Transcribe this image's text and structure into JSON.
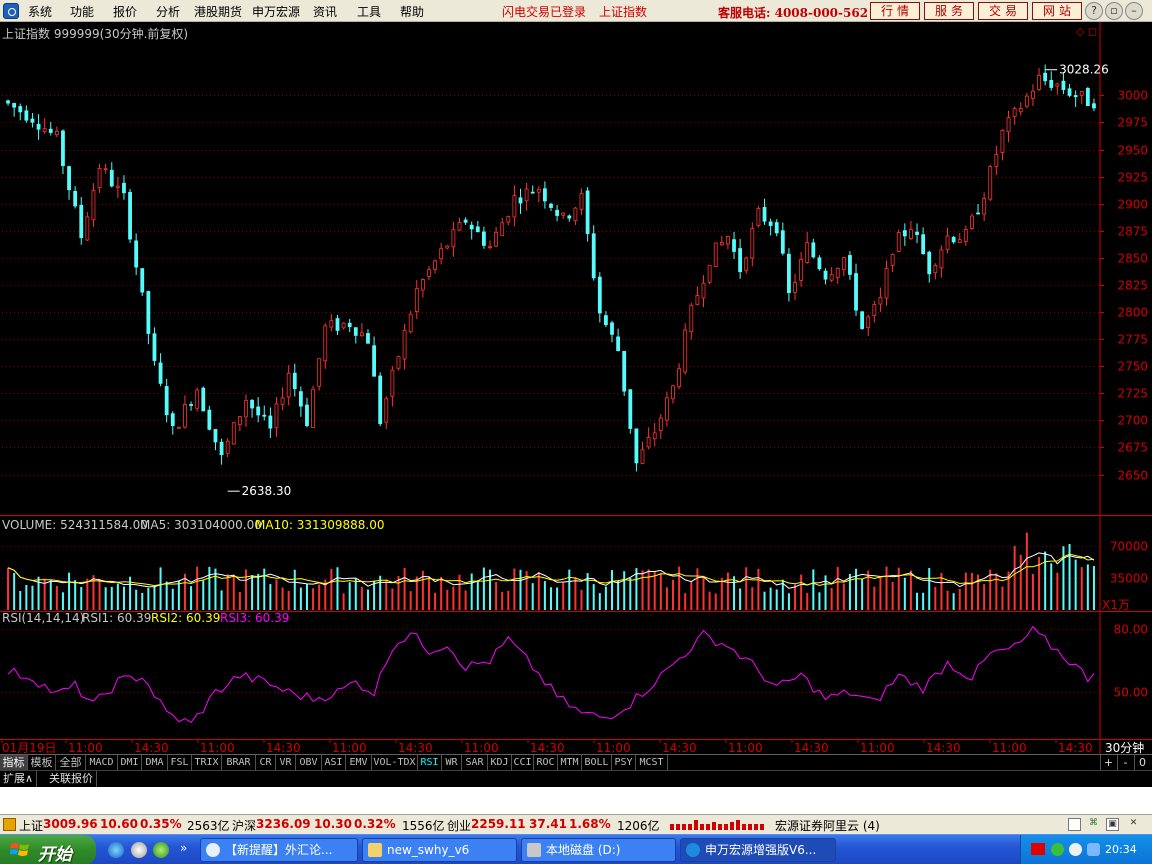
{
  "menubar": {
    "items": [
      "系统",
      "功能",
      "报价",
      "分析",
      "港股期货",
      "申万宏源",
      "资讯",
      "工具",
      "帮助"
    ],
    "notice_login": "闪电交易已登录",
    "notice_index": "上证指数",
    "hotline": "客服电话: 4008-000-562",
    "buttons": [
      "行情",
      "服务",
      "交易",
      "网站"
    ]
  },
  "chart_header": {
    "title": "上证指数 999999(30分钟.前复权)",
    "high_label": "3028.26",
    "low_label": "2638.30"
  },
  "volume_header": {
    "volume": "VOLUME: 524311584.00",
    "ma5": "MA5: 303104000.00",
    "ma10": "MA10: 331309888.00",
    "unit": "X1万"
  },
  "rsi_header": {
    "name": "RSI(14,14,14)",
    "rsi1": "RSI1: 60.39",
    "rsi2": "RSI2: 60.39",
    "rsi3": "RSI3: 60.39"
  },
  "chart_data": [
    {
      "type": "candlestick",
      "title": "上证指数 999999(30分钟.前复权)",
      "ylim": [
        2620,
        3040
      ],
      "y_ticks": [
        2650,
        2675,
        2700,
        2725,
        2750,
        2775,
        2800,
        2825,
        2850,
        2875,
        2900,
        2925,
        2950,
        2975,
        3000
      ],
      "high": 3028.26,
      "low": 2638.3,
      "anchors": [
        [
          0,
          2995
        ],
        [
          5,
          2980
        ],
        [
          9,
          2960
        ],
        [
          13,
          2870
        ],
        [
          16,
          2935
        ],
        [
          20,
          2905
        ],
        [
          25,
          2750
        ],
        [
          28,
          2690
        ],
        [
          32,
          2730
        ],
        [
          36,
          2665
        ],
        [
          40,
          2720
        ],
        [
          44,
          2690
        ],
        [
          47,
          2745
        ],
        [
          50,
          2700
        ],
        [
          53,
          2785
        ],
        [
          57,
          2790
        ],
        [
          60,
          2775
        ],
        [
          62,
          2700
        ],
        [
          65,
          2760
        ],
        [
          68,
          2820
        ],
        [
          72,
          2855
        ],
        [
          76,
          2885
        ],
        [
          80,
          2860
        ],
        [
          84,
          2905
        ],
        [
          88,
          2915
        ],
        [
          92,
          2885
        ],
        [
          95,
          2905
        ],
        [
          98,
          2800
        ],
        [
          101,
          2765
        ],
        [
          104,
          2660
        ],
        [
          107,
          2690
        ],
        [
          110,
          2730
        ],
        [
          113,
          2800
        ],
        [
          116,
          2850
        ],
        [
          119,
          2870
        ],
        [
          121,
          2840
        ],
        [
          124,
          2890
        ],
        [
          127,
          2880
        ],
        [
          129,
          2815
        ],
        [
          132,
          2860
        ],
        [
          135,
          2835
        ],
        [
          138,
          2850
        ],
        [
          141,
          2785
        ],
        [
          144,
          2810
        ],
        [
          146,
          2860
        ],
        [
          149,
          2880
        ],
        [
          152,
          2840
        ],
        [
          155,
          2870
        ],
        [
          158,
          2870
        ],
        [
          161,
          2910
        ],
        [
          164,
          2965
        ],
        [
          167,
          2990
        ],
        [
          170,
          3015
        ],
        [
          173,
          3010
        ],
        [
          176,
          3000
        ],
        [
          178,
          2995
        ]
      ],
      "candle_count": 179
    },
    {
      "type": "bar",
      "name": "VOLUME",
      "unit": "X1万",
      "ylim": [
        0,
        100000
      ],
      "y_ticks": [
        35000,
        70000
      ],
      "volume_last": 524311584.0,
      "ma5_last": 303104000.0,
      "ma10_last": 331309888.0
    },
    {
      "type": "line",
      "name": "RSI(14,14,14)",
      "ylim": [
        28,
        88
      ],
      "y_ticks": [
        50.0,
        80.0
      ],
      "rsi_last": 60.39,
      "anchors": [
        [
          0,
          60
        ],
        [
          4,
          57
        ],
        [
          8,
          49
        ],
        [
          11,
          53
        ],
        [
          14,
          44
        ],
        [
          18,
          55
        ],
        [
          22,
          58
        ],
        [
          26,
          40
        ],
        [
          30,
          35
        ],
        [
          34,
          50
        ],
        [
          38,
          58
        ],
        [
          42,
          55
        ],
        [
          46,
          50
        ],
        [
          50,
          47
        ],
        [
          54,
          50
        ],
        [
          57,
          55
        ],
        [
          60,
          50
        ],
        [
          63,
          72
        ],
        [
          66,
          78
        ],
        [
          69,
          70
        ],
        [
          72,
          73
        ],
        [
          75,
          62
        ],
        [
          79,
          65
        ],
        [
          82,
          75
        ],
        [
          86,
          62
        ],
        [
          90,
          48
        ],
        [
          94,
          40
        ],
        [
          98,
          38
        ],
        [
          102,
          45
        ],
        [
          106,
          55
        ],
        [
          110,
          66
        ],
        [
          114,
          77
        ],
        [
          118,
          72
        ],
        [
          122,
          63
        ],
        [
          126,
          52
        ],
        [
          130,
          58
        ],
        [
          134,
          47
        ],
        [
          138,
          50
        ],
        [
          142,
          45
        ],
        [
          146,
          58
        ],
        [
          150,
          52
        ],
        [
          154,
          64
        ],
        [
          158,
          57
        ],
        [
          161,
          68
        ],
        [
          165,
          71
        ],
        [
          168,
          79
        ],
        [
          171,
          72
        ],
        [
          174,
          65
        ],
        [
          177,
          57
        ],
        [
          178,
          60
        ]
      ]
    }
  ],
  "time_axis": {
    "labels": [
      "01月19日",
      "11:00",
      "14:30",
      "11:00",
      "14:30",
      "11:00",
      "14:30",
      "11:00",
      "14:30",
      "11:00",
      "14:30",
      "11:00",
      "14:30",
      "11:00",
      "14:30",
      "11:00",
      "14:30"
    ],
    "period": "30分钟"
  },
  "indicator_tabs": [
    "指标",
    "模板",
    "全部",
    "MACD",
    "DMI",
    "DMA",
    "FSL",
    "TRIX",
    "BRAR",
    "CR",
    "VR",
    "OBV",
    "ASI",
    "EMV",
    "VOL-TDX",
    "RSI",
    "WR",
    "SAR",
    "KDJ",
    "CCI",
    "ROC",
    "MTM",
    "BOLL",
    "PSY",
    "MCST"
  ],
  "indicator_controls": [
    "+",
    "-",
    "0"
  ],
  "ext_row": [
    "扩展∧",
    "关联报价"
  ],
  "status_bar": {
    "sh_label": "上证",
    "sh_price": "3009.96",
    "sh_change": "10.60",
    "sh_pct": "0.35%",
    "sh_amount": "2563亿",
    "sz_label": "沪深",
    "sz_price": "3236.09",
    "sz_change": "10.30",
    "sz_pct": "0.32%",
    "sz_amount": "1556亿",
    "cy_label": "创业",
    "cy_price": "2259.11",
    "cy_change": "37.41",
    "cy_pct": "1.68%",
    "cy_amount": "1206亿",
    "broker": "宏源证券阿里云 (4)"
  },
  "taskbar": {
    "start": "开始",
    "tasks": [
      "【新提醒】外汇论...",
      "new_swhy_v6",
      "本地磁盘 (D:)",
      "申万宏源增强版V6..."
    ],
    "clock": "20:34"
  },
  "colors": {
    "up": "#ff3232",
    "down": "#54fcfc",
    "grid": "#800000",
    "axis": "#d00000",
    "ma5": "#ffffff",
    "ma10": "#ffff00",
    "rsi": "#ff00ff",
    "flat": "#ffffff"
  }
}
